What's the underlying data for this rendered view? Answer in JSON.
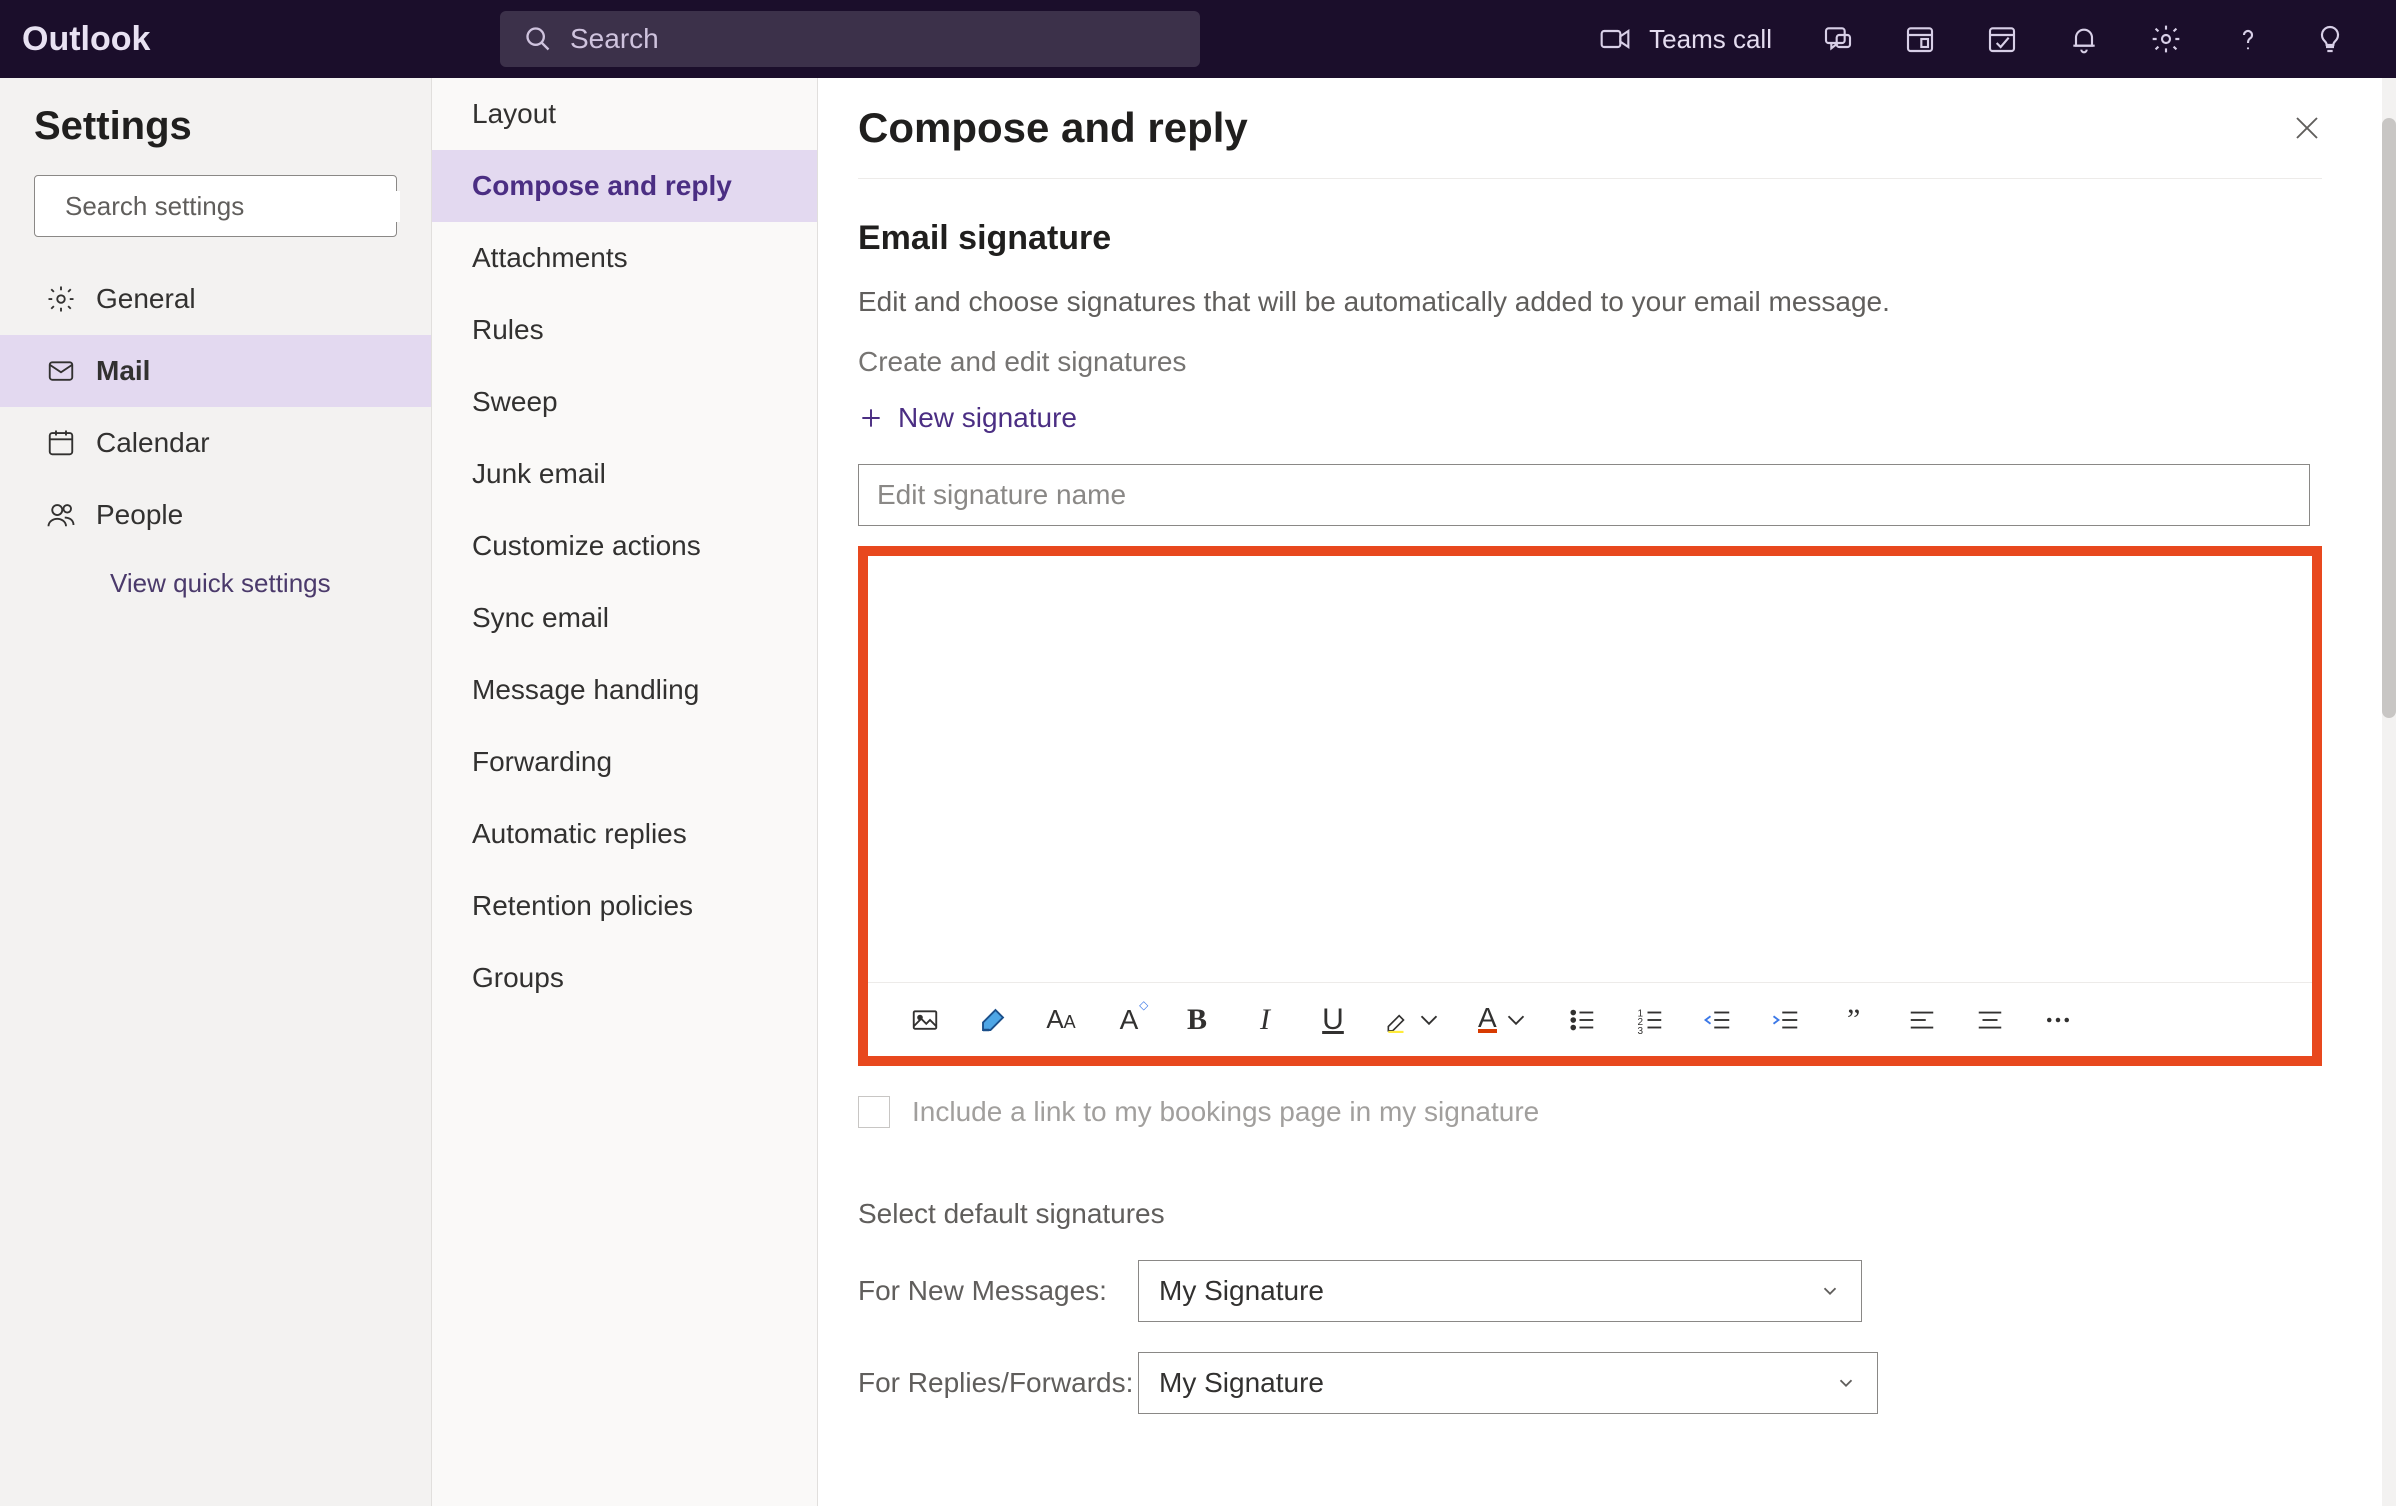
{
  "topbar": {
    "brand": "Outlook",
    "search_placeholder": "Search",
    "teams_call": "Teams call"
  },
  "settings": {
    "title": "Settings",
    "search_placeholder": "Search settings",
    "categories": {
      "general": "General",
      "mail": "Mail",
      "calendar": "Calendar",
      "people": "People"
    },
    "quick_link": "View quick settings"
  },
  "mail_subnav": {
    "layout": "Layout",
    "compose_reply": "Compose and reply",
    "attachments": "Attachments",
    "rules": "Rules",
    "sweep": "Sweep",
    "junk_email": "Junk email",
    "customize_actions": "Customize actions",
    "sync_email": "Sync email",
    "message_handling": "Message handling",
    "forwarding": "Forwarding",
    "automatic_replies": "Automatic replies",
    "retention_policies": "Retention policies",
    "groups": "Groups"
  },
  "panel": {
    "title": "Compose and reply",
    "section_title": "Email signature",
    "description": "Edit and choose signatures that will be automatically added to your email message.",
    "create_edit_label": "Create and edit signatures",
    "new_signature": "New signature",
    "name_placeholder": "Edit signature name",
    "bookings_checkbox": "Include a link to my bookings page in my signature",
    "select_heading": "Select default signatures",
    "for_new": "For New Messages:",
    "for_replies": "For Replies/Forwards:",
    "selected_new": "My Signature",
    "selected_replies": "My Signature"
  }
}
